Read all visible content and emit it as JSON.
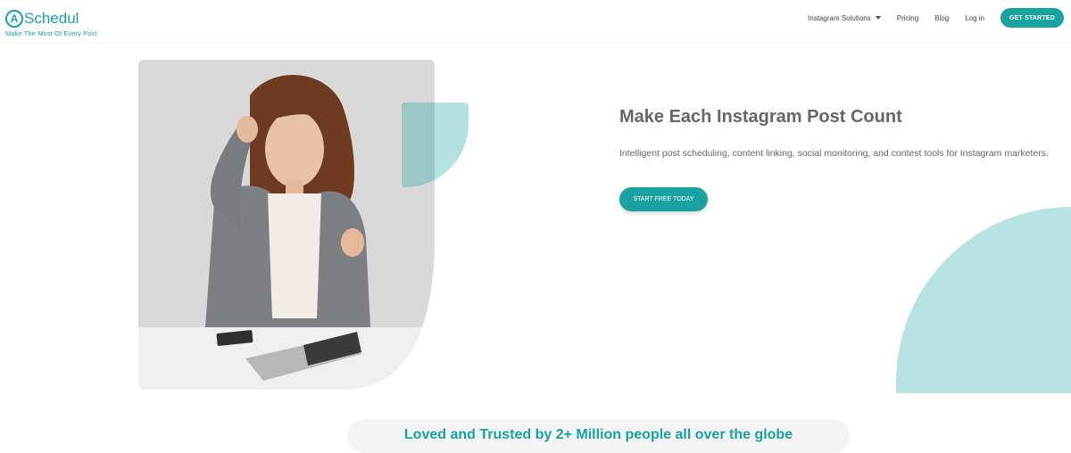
{
  "brand": {
    "name": "Schedul",
    "mark": "A",
    "tagline": "Make The Most Of Every Post",
    "accent": "#1aa2a0"
  },
  "nav": {
    "items": [
      "Instagram Solutions",
      "Pricing",
      "Blog",
      "Log in"
    ],
    "cta": "GET STARTED"
  },
  "hero": {
    "title": "Make Each Instagram Post Count",
    "subtitle": "Intelligent post scheduling, content linking, social monitoring, and contest tools for Instagram marketers.",
    "cta": "START FREE TODAY",
    "image": "woman-with-laptop-photo"
  },
  "trust": {
    "text": "Loved and Trusted by 2+ Million people all over the globe"
  },
  "colors": {
    "accent": "#1aa2a0",
    "accent_light": "#b9e3e2"
  }
}
